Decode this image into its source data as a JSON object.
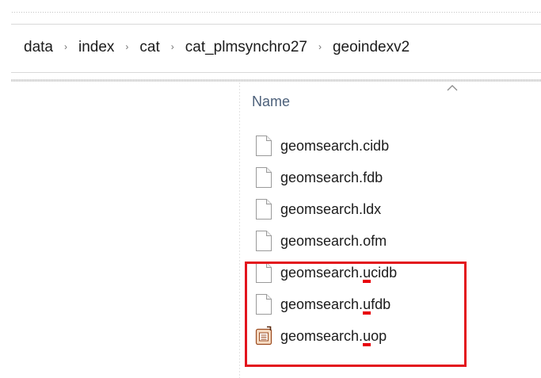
{
  "breadcrumb": {
    "items": [
      "data",
      "index",
      "cat",
      "cat_plmsynchro27",
      "geoindexv2"
    ],
    "separator": "›"
  },
  "columns": {
    "name_header": "Name",
    "sort_icon": "chevron-up-icon"
  },
  "files": [
    {
      "base": "geomsearch.",
      "ext_first": "c",
      "ext_rest": "idb",
      "icon": "blank-file-icon",
      "marked": false
    },
    {
      "base": "geomsearch.",
      "ext_first": "f",
      "ext_rest": "db",
      "icon": "blank-file-icon",
      "marked": false
    },
    {
      "base": "geomsearch.",
      "ext_first": "l",
      "ext_rest": "dx",
      "icon": "blank-file-icon",
      "marked": false
    },
    {
      "base": "geomsearch.",
      "ext_first": "o",
      "ext_rest": "fm",
      "icon": "blank-file-icon",
      "marked": false
    },
    {
      "base": "geomsearch.",
      "ext_first": "u",
      "ext_rest": "cidb",
      "icon": "blank-file-icon",
      "marked": true
    },
    {
      "base": "geomsearch.",
      "ext_first": "u",
      "ext_rest": "fdb",
      "icon": "blank-file-icon",
      "marked": true
    },
    {
      "base": "geomsearch.",
      "ext_first": "u",
      "ext_rest": "op",
      "icon": "project-file-icon",
      "marked": true
    }
  ],
  "colors": {
    "highlight": "#e3141d",
    "underline_mark": "#e8000b",
    "header_text": "#4c607a"
  }
}
